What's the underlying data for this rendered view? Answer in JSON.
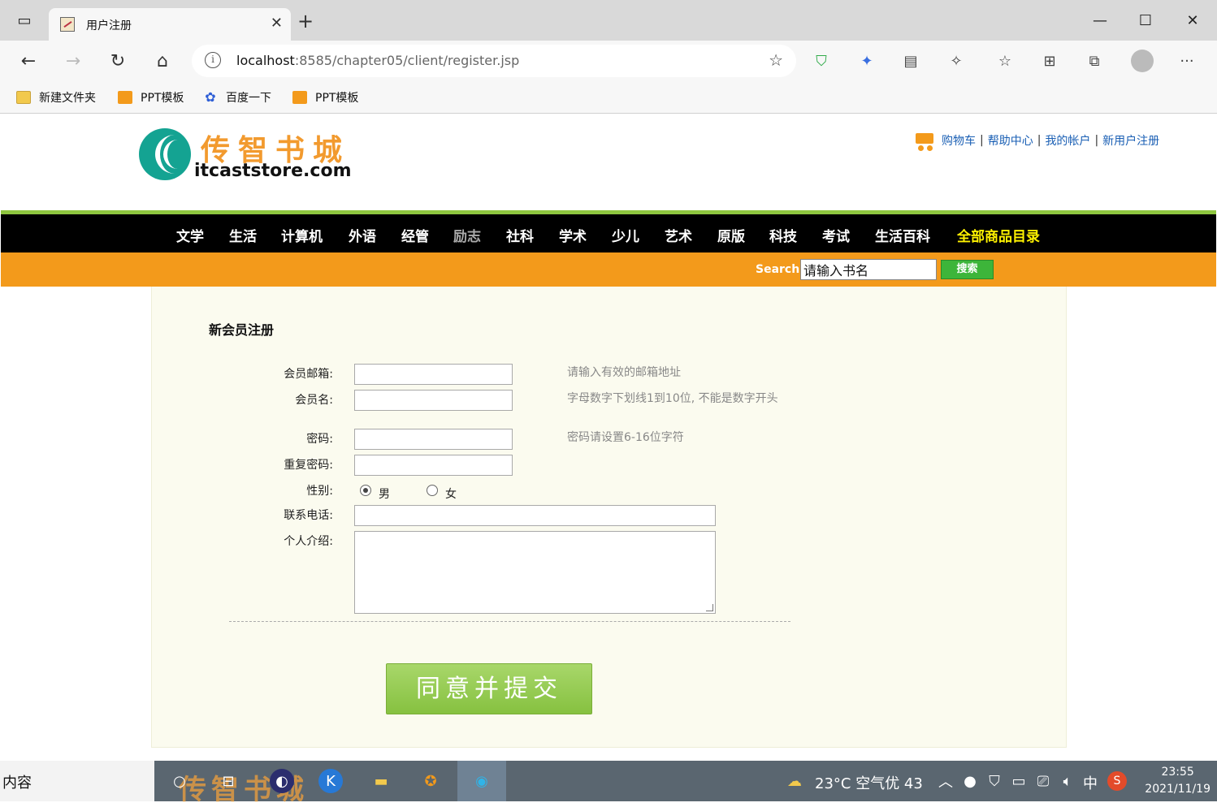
{
  "browser": {
    "tab_title": "用户注册",
    "new_tab": "+",
    "url_host": "localhost",
    "url_rest": ":8585/chapter05/client/register.jsp",
    "bookmarks": [
      "新建文件夹",
      "PPT模板",
      "百度一下",
      "PPT模板"
    ]
  },
  "header": {
    "logo_cn": "传智书城",
    "logo_en": "itcaststore.com",
    "links": [
      "购物车",
      "帮助中心",
      "我的帐户",
      "新用户注册"
    ],
    "sep": "|"
  },
  "categories": [
    "文学",
    "生活",
    "计算机",
    "外语",
    "经管",
    "励志",
    "社科",
    "学术",
    "少儿",
    "艺术",
    "原版",
    "科技",
    "考试",
    "生活百科",
    "全部商品目录"
  ],
  "search": {
    "label": "Search",
    "placeholder": "请输入书名",
    "button": "搜索"
  },
  "form": {
    "heading": "新会员注册",
    "fields": {
      "email": "会员邮箱:",
      "username": "会员名:",
      "password": "密码:",
      "repassword": "重复密码:",
      "gender": "性别:",
      "phone": "联系电话:",
      "intro": "个人介绍:"
    },
    "hints": {
      "email": "请输入有效的邮箱地址",
      "username": "字母数字下划线1到10位, 不能是数字开头",
      "password": "密码请设置6-16位字符"
    },
    "gender_options": [
      "男",
      "女"
    ],
    "gender_selected": "男",
    "submit": "同意并提交"
  },
  "taskbar": {
    "search_text": "内容",
    "weather": "23°C  空气优 43",
    "ime": "中",
    "time": "23:55",
    "date": "2021/11/19"
  },
  "colors": {
    "nav_green": "#8ec63f",
    "search_orange": "#f39a1b",
    "all_goods_yellow": "#fff200",
    "submit_green": "#86c140"
  }
}
